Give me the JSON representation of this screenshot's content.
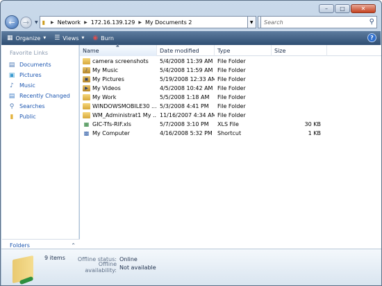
{
  "window": {
    "controls": [
      "minimize",
      "maximize",
      "close"
    ]
  },
  "address_bar": {
    "crumbs": [
      "Network",
      "172.16.139.129",
      "My Documents 2"
    ]
  },
  "search": {
    "placeholder": "Search"
  },
  "toolbar": {
    "organize_label": "Organize",
    "views_label": "Views",
    "burn_label": "Burn",
    "help_label": "?"
  },
  "nav_pane": {
    "title": "Favorite Links",
    "items": [
      {
        "label": "Documents",
        "icon": "documents-icon"
      },
      {
        "label": "Pictures",
        "icon": "pictures-icon"
      },
      {
        "label": "Music",
        "icon": "music-icon"
      },
      {
        "label": "Recently Changed",
        "icon": "recently-changed-icon"
      },
      {
        "label": "Searches",
        "icon": "searches-icon"
      },
      {
        "label": "Public",
        "icon": "public-folder-icon"
      }
    ],
    "folders_label": "Folders"
  },
  "list": {
    "columns": [
      "Name",
      "Date modified",
      "Type",
      "Size"
    ],
    "rows": [
      {
        "name": "camera screenshots",
        "date": "5/4/2008 11:39 AM",
        "type": "File Folder",
        "size": "",
        "icon": "folder"
      },
      {
        "name": "My Music",
        "date": "5/4/2008 11:59 AM",
        "type": "File Folder",
        "size": "",
        "icon": "special"
      },
      {
        "name": "My Pictures",
        "date": "5/19/2008 12:33 AM",
        "type": "File Folder",
        "size": "",
        "icon": "special"
      },
      {
        "name": "My Videos",
        "date": "4/5/2008 10:42 AM",
        "type": "File Folder",
        "size": "",
        "icon": "special"
      },
      {
        "name": "My Work",
        "date": "5/5/2008 1:18 AM",
        "type": "File Folder",
        "size": "",
        "icon": "folder"
      },
      {
        "name": "WINDOWSMOBILE30 ...",
        "date": "5/3/2008 4:41 PM",
        "type": "File Folder",
        "size": "",
        "icon": "folder"
      },
      {
        "name": "WM_Administrat1 My ...",
        "date": "11/16/2007 4:34 AM",
        "type": "File Folder",
        "size": "",
        "icon": "folder"
      },
      {
        "name": "GIC-Tfs-RIF.xls",
        "date": "5/7/2008 3:10 PM",
        "type": "XLS File",
        "size": "30 KB",
        "icon": "xls"
      },
      {
        "name": "My Computer",
        "date": "4/16/2008 5:32 PM",
        "type": "Shortcut",
        "size": "1 KB",
        "icon": "pc"
      }
    ]
  },
  "details": {
    "item_count": "9 items",
    "properties": [
      {
        "key": "Offline status:",
        "value": "Online"
      },
      {
        "key": "Offline availability:",
        "value": "Not available"
      }
    ]
  }
}
